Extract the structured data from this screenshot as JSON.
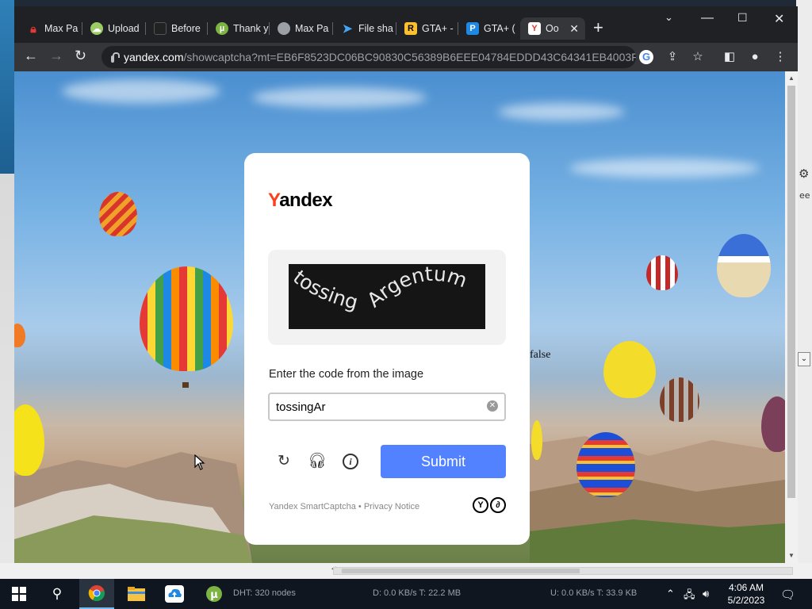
{
  "browser": {
    "tabs": [
      {
        "label": "Max Pa",
        "icon": "lock-icon",
        "color": "#e53935",
        "active": false
      },
      {
        "label": "Upload",
        "icon": "cloud-icon",
        "color": "#9ccc65",
        "active": false
      },
      {
        "label": "Before",
        "icon": "shield-icon",
        "color": "#37474f",
        "active": false
      },
      {
        "label": "Thank y",
        "icon": "utorrent-icon",
        "color": "#7cb342",
        "active": false
      },
      {
        "label": "Max Pa",
        "icon": "globe-icon",
        "color": "#9aa0a6",
        "active": false
      },
      {
        "label": "File sha",
        "icon": "wing-icon",
        "color": "#42a5f5",
        "active": false
      },
      {
        "label": "GTA+ -",
        "icon": "rockstar-icon",
        "color": "#fbc02d",
        "active": false
      },
      {
        "label": "GTA+ (",
        "icon": "playstation-icon",
        "color": "#1e88e5",
        "active": false
      },
      {
        "label": "Oo",
        "icon": "yandex-icon",
        "color": "#e53935",
        "active": true
      }
    ],
    "url_host": "yandex.com",
    "url_path": "/showcaptcha?mt=EB6F8523DC06BC90830C56389B6EEE04784EDDD43C64341EB4003FD..."
  },
  "page": {
    "stray_text": "false"
  },
  "captcha": {
    "brand_first": "Y",
    "brand_rest": "andex",
    "image_words": [
      "tossing",
      "Argentum"
    ],
    "prompt": "Enter the code from the image",
    "input_value": "tossingAr",
    "submit_label": "Submit",
    "footer": "Yandex SmartCaptcha • Privacy Notice",
    "accent": "#5282ff",
    "brand_color": "#fc3f1d"
  },
  "taskbar": {
    "dht_status": "DHT: 320 nodes",
    "download_status": "D: 0.0 KB/s T: 22.2 MB",
    "upload_status": "U: 0.0 KB/s T: 33.9 KB",
    "time": "4:06 AM",
    "date": "5/2/2023"
  }
}
